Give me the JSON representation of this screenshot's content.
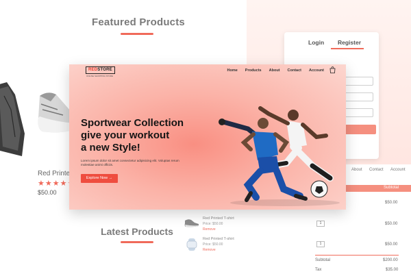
{
  "featured": {
    "title": "Featured Products",
    "product_name": "Red Printe",
    "stars": "★★★★☆",
    "price": "$50.00"
  },
  "latest": {
    "title": "Latest Products"
  },
  "login": {
    "tabs": [
      "Login",
      "Register"
    ]
  },
  "cart": {
    "nav": [
      "About",
      "Contact",
      "Account"
    ],
    "header_label": "Subtotal",
    "items": [
      {
        "name": "Red Printed T-shirt",
        "price": "Price: $50.00",
        "remove": "Remove",
        "quantity": "1"
      },
      {
        "name": "Red Printed T-shirt",
        "price": "Price: $50.00",
        "remove": "Remove",
        "quantity": "1"
      }
    ],
    "prices": [
      "$50.00",
      "$50.00",
      "$50.00"
    ],
    "subtotal_label": "Subtotal",
    "subtotal_value": "$200.00",
    "tax_label": "Tax",
    "tax_value": "$35.00"
  },
  "hero": {
    "logo_red": "RED",
    "logo_dark": "STORE",
    "logo_tagline": "ONLINE SHOPPING STORE",
    "nav": [
      "Home",
      "Products",
      "About",
      "Contact",
      "Account"
    ],
    "title_line1": "Sportwear Collection",
    "title_line2": "give your workout",
    "title_line3": "a new Style!",
    "subtitle": "Lorem ipsum dolor sit amet consectetur adipisicing elit. Voluptas rerum molestiae animi officiis.",
    "cta": "Explore Now →"
  },
  "colors": {
    "accent": "#f06a5a",
    "button": "#ef4d3f",
    "hero_center": "#f98f82",
    "hero_edge": "#fcd6cf"
  },
  "icons": [
    "shopping-bag-icon",
    "jacket-image",
    "sneaker-image",
    "soccer-players-image",
    "shoe-thumb-image",
    "watch-thumb-image"
  ]
}
